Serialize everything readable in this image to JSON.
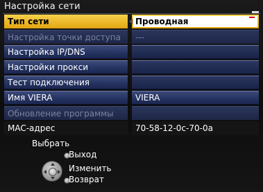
{
  "title": "Настройка сети",
  "menu": {
    "items": [
      {
        "label": "Тип сети",
        "value": "Проводная",
        "state": "selected"
      },
      {
        "label": "Настройка точки доступа",
        "value": "---",
        "state": "disabled"
      },
      {
        "label": "Настройка IP/DNS",
        "value": "",
        "state": "normal"
      },
      {
        "label": "Настройки прокси",
        "value": "",
        "state": "normal"
      },
      {
        "label": "Тест подключения",
        "value": "",
        "state": "normal"
      },
      {
        "label": "Имя VIERA",
        "value": "VIERA",
        "state": "normal"
      },
      {
        "label": "Обновление программы",
        "value": "",
        "state": "disabled"
      },
      {
        "label": "MAC-адрес",
        "value": "70-58-12-0c-70-0a",
        "state": "info"
      }
    ]
  },
  "help": {
    "select": "Выбрать",
    "exit": "Выход",
    "change": "Изменить",
    "return": "Возврат"
  },
  "colors": {
    "selected": "#f0c030",
    "row": "#2a3868",
    "disabled_text": "#7a82a0"
  }
}
